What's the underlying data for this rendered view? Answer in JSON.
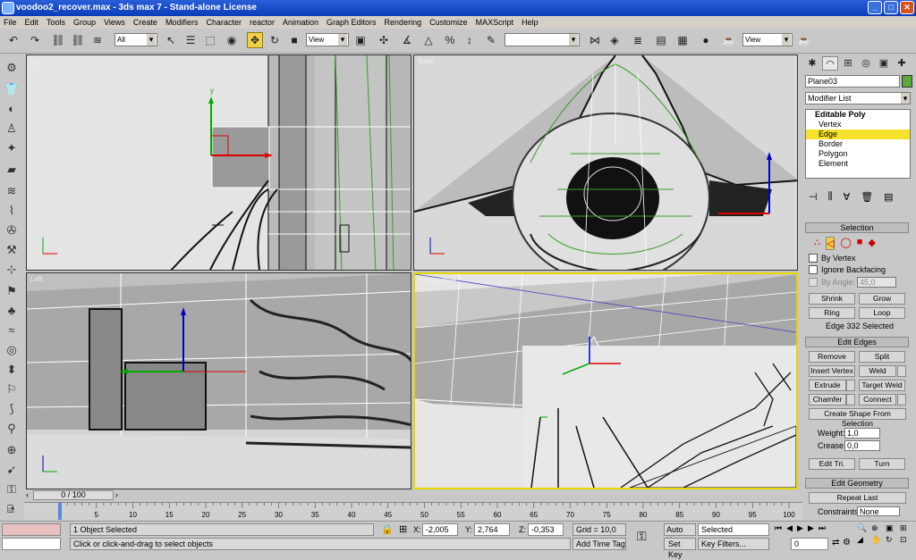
{
  "window": {
    "title": "voodoo2_recover.max - 3ds max 7 - Stand-alone License",
    "controls": [
      "_",
      "□",
      "✕"
    ]
  },
  "menu": [
    "File",
    "Edit",
    "Tools",
    "Group",
    "Views",
    "Create",
    "Modifiers",
    "Character",
    "reactor",
    "Animation",
    "Graph Editors",
    "Rendering",
    "Customize",
    "MAXScript",
    "Help"
  ],
  "toolbar": {
    "selection_filter": "All",
    "ref_coord": "View",
    "named_sel": "",
    "ref_coord2": "View"
  },
  "viewports": {
    "top": "Top",
    "back": "Back",
    "left": "Left",
    "perspective": "Perspective"
  },
  "axis": {
    "x": "x",
    "y": "y",
    "z": "z"
  },
  "command_panel": {
    "object_name": "Plane03",
    "object_color": "#5aa838",
    "modifier_list": "Modifier List",
    "stack": {
      "top": "Editable Poly",
      "items": [
        "Vertex",
        "Edge",
        "Border",
        "Polygon",
        "Element"
      ],
      "selected": "Edge"
    },
    "selection": {
      "title": "Selection",
      "by_vertex": "By Vertex",
      "ignore_backfacing": "Ignore Backfacing",
      "by_angle": "By Angle:",
      "angle_value": "45,0",
      "shrink": "Shrink",
      "grow": "Grow",
      "ring": "Ring",
      "loop": "Loop",
      "status": "Edge 332 Selected"
    },
    "edit_edges": {
      "title": "Edit Edges",
      "remove": "Remove",
      "split": "Split",
      "insert_vertex": "Insert Vertex",
      "weld": "Weld",
      "extrude": "Extrude",
      "target_weld": "Target Weld",
      "chamfer": "Chamfer",
      "connect": "Connect",
      "create_shape": "Create Shape From Selection",
      "weight_label": "Weight:",
      "weight_value": "1,0",
      "crease_label": "Crease:",
      "crease_value": "0,0",
      "edit_tri": "Edit Tri.",
      "turn": "Turn"
    },
    "edit_geometry": {
      "title": "Edit Geometry",
      "repeat_last": "Repeat Last",
      "constraints": "Constraints:",
      "constraints_value": "None"
    }
  },
  "time": {
    "slider": "0 / 100",
    "ticks": [
      "0",
      "5",
      "10",
      "15",
      "20",
      "25",
      "30",
      "35",
      "40",
      "45",
      "50",
      "55",
      "60",
      "65",
      "70",
      "75",
      "80",
      "85",
      "90",
      "95",
      "100"
    ]
  },
  "status": {
    "selected": "1 Object Selected",
    "prompt": "Click or click-and-drag to select objects",
    "x_label": "X:",
    "x": "-2,005",
    "y_label": "Y:",
    "y": "2,764",
    "z_label": "Z:",
    "z": "-0,353",
    "grid": "Grid = 10,0",
    "add_time_tag": "Add Time Tag",
    "auto_key": "Auto Key",
    "set_key": "Set Key",
    "selected_dd": "Selected",
    "key_filters": "Key Filters...",
    "frame": "0"
  }
}
